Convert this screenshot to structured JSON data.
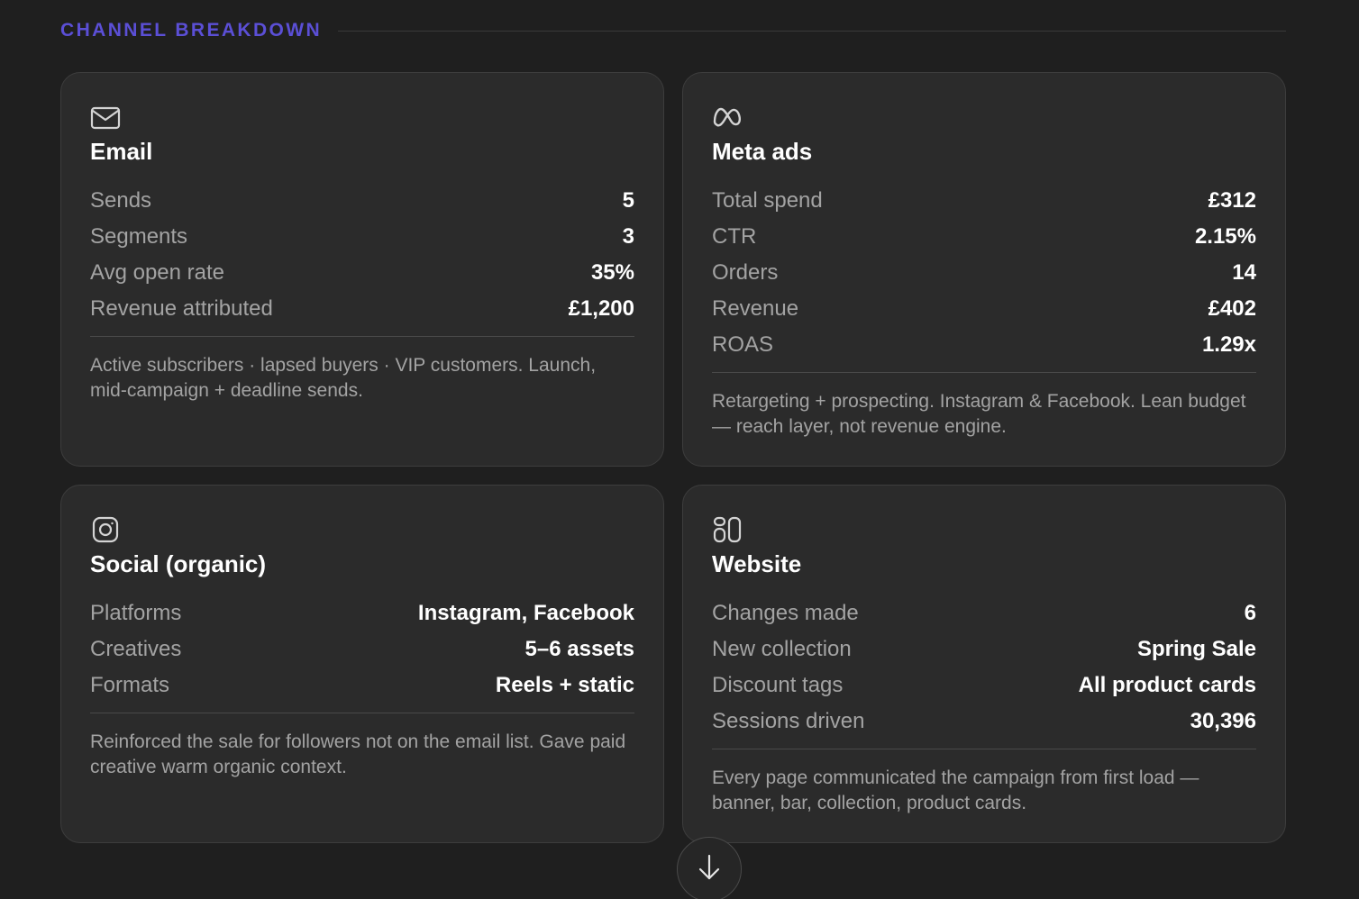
{
  "section": {
    "title": "CHANNEL BREAKDOWN"
  },
  "colors": {
    "accent": "#5b4fd6",
    "background": "#1f1f1f",
    "card": "#2b2b2b"
  },
  "cards": {
    "email": {
      "icon": "mail-icon",
      "title": "Email",
      "rows": [
        {
          "label": "Sends",
          "value": "5"
        },
        {
          "label": "Segments",
          "value": "3"
        },
        {
          "label": "Avg open rate",
          "value": "35%"
        },
        {
          "label": "Revenue attributed",
          "value": "£1,200"
        }
      ],
      "note": "Active subscribers · lapsed buyers · VIP customers. Launch, mid-campaign + deadline sends."
    },
    "meta": {
      "icon": "meta-icon",
      "title": "Meta ads",
      "rows": [
        {
          "label": "Total spend",
          "value": "£312"
        },
        {
          "label": "CTR",
          "value": "2.15%"
        },
        {
          "label": "Orders",
          "value": "14"
        },
        {
          "label": "Revenue",
          "value": "£402"
        },
        {
          "label": "ROAS",
          "value": "1.29x"
        }
      ],
      "note": "Retargeting + prospecting. Instagram & Facebook. Lean budget — reach layer, not revenue engine."
    },
    "social": {
      "icon": "instagram-icon",
      "title": "Social (organic)",
      "rows": [
        {
          "label": "Platforms",
          "value": "Instagram, Facebook"
        },
        {
          "label": "Creatives",
          "value": "5–6 assets"
        },
        {
          "label": "Formats",
          "value": "Reels + static"
        }
      ],
      "note": "Reinforced the sale for followers not on the email list. Gave paid creative warm organic context."
    },
    "website": {
      "icon": "website-icon",
      "title": "Website",
      "rows": [
        {
          "label": "Changes made",
          "value": "6"
        },
        {
          "label": "New collection",
          "value": "Spring Sale"
        },
        {
          "label": "Discount tags",
          "value": "All product cards"
        },
        {
          "label": "Sessions driven",
          "value": "30,396"
        }
      ],
      "note": "Every page communicated the campaign from first load — banner, bar, collection, product cards."
    }
  },
  "scroll_button": {
    "icon": "arrow-down-icon"
  }
}
